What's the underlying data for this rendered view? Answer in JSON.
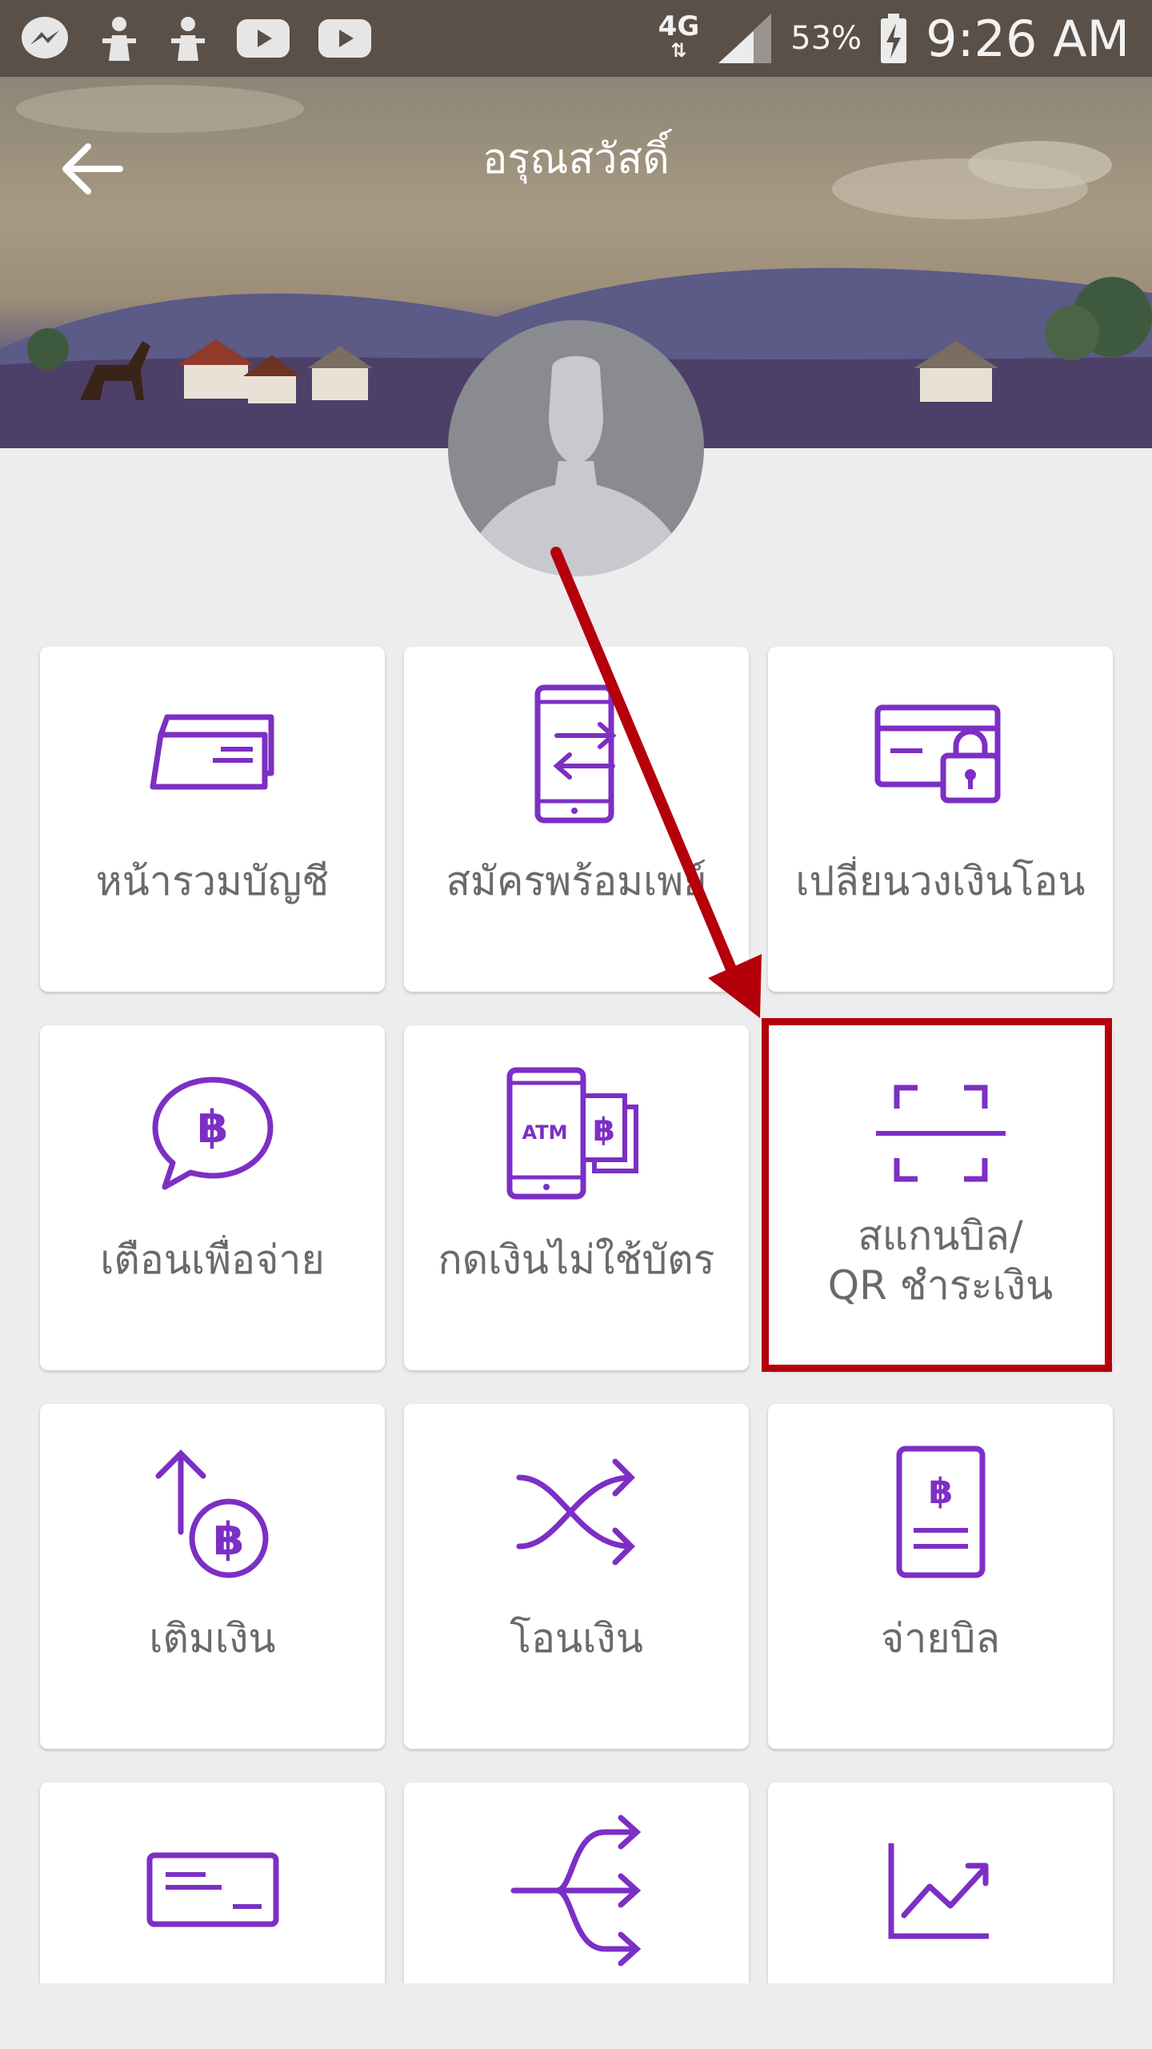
{
  "status_bar": {
    "network": "4G",
    "battery": "53%",
    "time": "9:26 AM"
  },
  "header": {
    "title": "อรุณสวัสดิ์"
  },
  "menu": {
    "items": [
      {
        "label": "หน้ารวมบัญชี",
        "icon": "card-stack-icon"
      },
      {
        "label": "สมัครพร้อมเพย์",
        "icon": "phone-transfer-icon"
      },
      {
        "label": "เปลี่ยนวงเงินโอน",
        "icon": "card-lock-icon"
      },
      {
        "label": "เตือนเพื่อจ่าย",
        "icon": "baht-chat-icon"
      },
      {
        "label": "กดเงินไม่ใช้บัตร",
        "icon_text": "ATM",
        "icon": "atm-phone-icon"
      },
      {
        "label_line1": "สแกนบิล/",
        "label_line2": "QR ชำระเงิน",
        "icon": "scan-icon"
      },
      {
        "label": "เติมเงิน",
        "icon": "topup-baht-icon"
      },
      {
        "label": "โอนเงิน",
        "icon": "shuffle-transfer-icon"
      },
      {
        "label": "จ่ายบิล",
        "icon": "bill-icon"
      },
      {
        "label": "",
        "icon": "card-icon"
      },
      {
        "label": "",
        "icon": "split-arrows-icon"
      },
      {
        "label": "",
        "icon": "chart-up-icon"
      }
    ]
  },
  "colors": {
    "accent": "#7c2fc4",
    "highlight": "#b5000c"
  }
}
